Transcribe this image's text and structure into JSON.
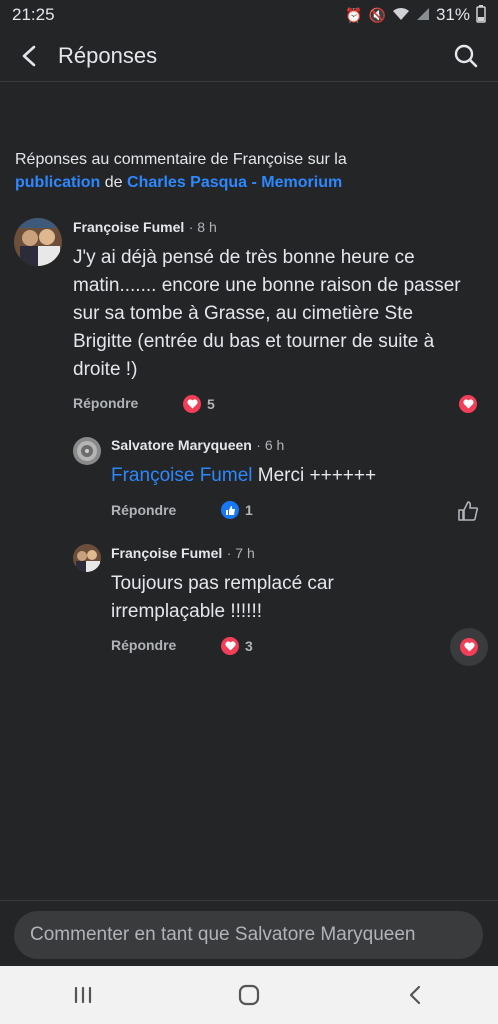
{
  "status": {
    "time": "21:25",
    "battery": "31%"
  },
  "header": {
    "title": "Réponses"
  },
  "context": {
    "prefix": "Réponses au commentaire de Françoise sur la",
    "link1": "publication",
    "middle": " de ",
    "link2": "Charles Pasqua - Memorium"
  },
  "comments": [
    {
      "author": "Françoise Fumel",
      "time": "· 8 h",
      "text": "J'y ai déjà pensé de très bonne heure ce matin....... encore une bonne raison de passer sur sa tombe à Grasse, au cimetière Ste Brigitte (entrée du bas et tourner de suite à droite !)",
      "reply": "Répondre",
      "reaction": "heart",
      "count": "5"
    },
    {
      "author": "Salvatore Maryqueen",
      "time": "· 6 h",
      "mention": "Françoise Fumel",
      "text": " Merci ++++++",
      "reply": "Répondre",
      "reaction": "like",
      "count": "1"
    },
    {
      "author": "Françoise Fumel",
      "time": "· 7 h",
      "text": "Toujours pas remplacé car irremplaçable !!!!!!",
      "reply": "Répondre",
      "reaction": "heart",
      "count": "3"
    }
  ],
  "composer": {
    "placeholder": "Commenter en tant que Salvatore Maryqueen"
  },
  "colors": {
    "background": "#242526",
    "link": "#2d88ff",
    "heart": "#f33e58",
    "like": "#1877f2"
  }
}
